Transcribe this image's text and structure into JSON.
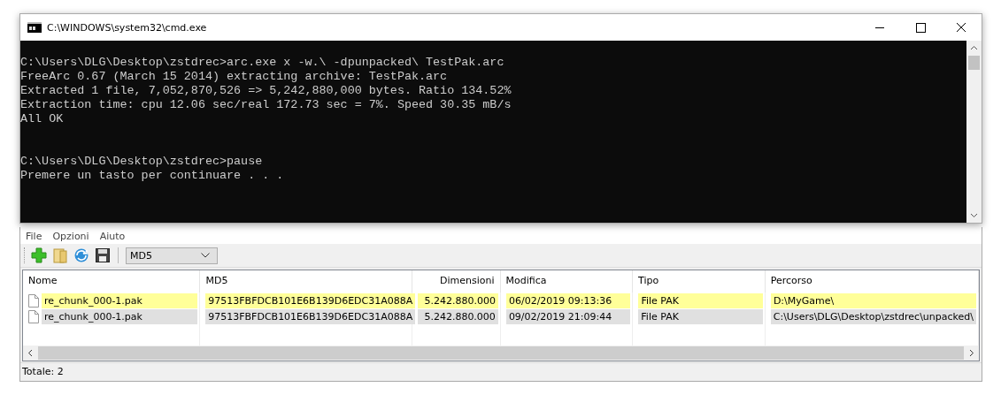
{
  "console_window": {
    "title": "C:\\WINDOWS\\system32\\cmd.exe",
    "output_blocks": [
      [
        "C:\\Users\\DLG\\Desktop\\zstdrec>arc.exe x -w.\\ -dpunpacked\\ TestPak.arc",
        "FreeArc 0.67 (March 15 2014) extracting archive: TestPak.arc",
        "Extracted 1 file, 7,052,870,526 => 5,242,880,000 bytes. Ratio 134.52%",
        "Extraction time: cpu 12.06 sec/real 172.73 sec = 7%. Speed 30.35 mB/s",
        "All OK"
      ],
      [
        "C:\\Users\\DLG\\Desktop\\zstdrec>pause",
        "Premere un tasto per continuare . . ."
      ]
    ]
  },
  "app_window": {
    "menu": [
      "File",
      "Opzioni",
      "Aiuto"
    ],
    "hash_select": {
      "value": "MD5"
    },
    "table": {
      "columns": [
        "Nome",
        "MD5",
        "Dimensioni",
        "Modifica",
        "Tipo",
        "Percorso"
      ],
      "rows": [
        {
          "color": "#ffff99",
          "cells": [
            "re_chunk_000-1.pak",
            "97513FBFDCB101E6B139D6EDC31A088A",
            "5.242.880.000",
            "06/02/2019 09:13:36",
            "File PAK",
            "D:\\MyGame\\"
          ]
        },
        {
          "color": "#e0e0e0",
          "cells": [
            "re_chunk_000-1.pak",
            "97513FBFDCB101E6B139D6EDC31A088A",
            "5.242.880.000",
            "09/02/2019 21:09:44",
            "File PAK",
            "C:\\Users\\DLG\\Desktop\\zstdrec\\unpacked\\"
          ]
        }
      ]
    },
    "status_bar": "Totale: 2"
  }
}
